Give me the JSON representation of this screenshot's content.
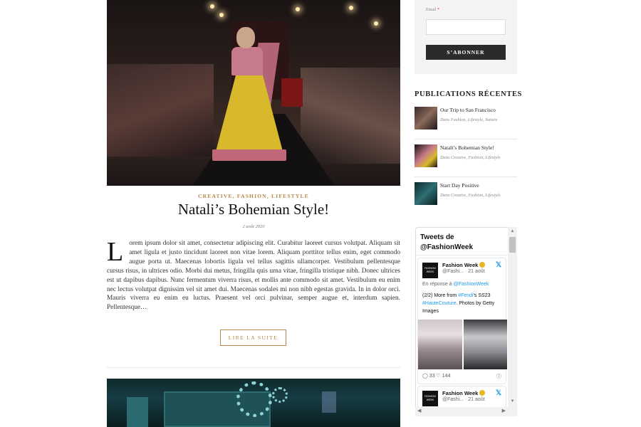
{
  "post": {
    "categories": "CREATIVE, FASHION, LIFESTYLE",
    "title": "Natali’s Bohemian Style!",
    "date": "2 août 2020",
    "dropcap": "L",
    "excerpt": "orem ipsum dolor sit amet, consectetur adipiscing elit. Curabitur laoreet cursus volutpat. Aliquam sit amet ligula et justo tincidunt laoreet non vitae lorem. Aliquam porttitor tellus enim, eget commodo augue porta ut. Maecenas lobortis ligula vel tellus sagittis ullamcorper. Vestibulum pellentesque cursus risus, in ultrices odio. Morbi dui metus, fringilla quis urna vitae, fringilla tristique nibh. Donec ultrices est ut dapibus dapibus. Nunc fermentum viverra risus, et mollis ante commodo sit amet. Vestibulum eu enim nec lectus volutpat dignissim vel sit amet dui. Maecenas sodales mi non nibh egestas gravida. In in dolor orci. Mauris viverra eu enim eu luctus. Praesent vel orci pulvinar, semper augue et, interdum sapien. Pellentesque…",
    "read_more_label": "LIRE LA SUITE"
  },
  "subscribe": {
    "email_label": "Email",
    "required_mark": "*",
    "button_label": "S’ABONNER"
  },
  "recent_posts": {
    "heading": "PUBLICATIONS RÉCENTES",
    "items": [
      {
        "title": "Our Trip to San Francisco",
        "categories": "Dans Fashion, Lifestyle, Nature"
      },
      {
        "title": "Natali’s Bohemian Style!",
        "categories": "Dans Creative, Fashion, Lifestyle"
      },
      {
        "title": "Start Day Positive",
        "categories": "Dans Creative, Fashion, Lifestyle"
      }
    ]
  },
  "twitter": {
    "header": "Tweets de @FashionWeek",
    "tweets": [
      {
        "avatar_text": "FASHION WEEK",
        "name": "Fashion Week",
        "handle": "@Fashi...",
        "date": "· 21 août",
        "reply_prefix": "En réponse à",
        "reply_handle": "@FashionWeek",
        "text_a": "(2/2) More from",
        "text_link_a": "#Fendi",
        "text_b": "'s SS23",
        "text_link_b": "#HauteCouture",
        "text_c": ". Photos by Getty Images",
        "replies": "33",
        "likes": "144"
      },
      {
        "avatar_text": "FASHION WEEK",
        "name": "Fashion Week",
        "handle": "@Fashi...",
        "date": "· 21 août"
      }
    ]
  },
  "icons": {
    "x_logo": "𝕏",
    "reply": "◯",
    "like": "♡",
    "info": "ⓘ",
    "scroll_up": "▲",
    "scroll_down": "▼",
    "scroll_left": "◀",
    "scroll_right": "▶"
  },
  "colors": {
    "accent_gold": "#b5894b",
    "button_dark": "#2b2b2b",
    "twitter_blue": "#1d9bf0"
  }
}
